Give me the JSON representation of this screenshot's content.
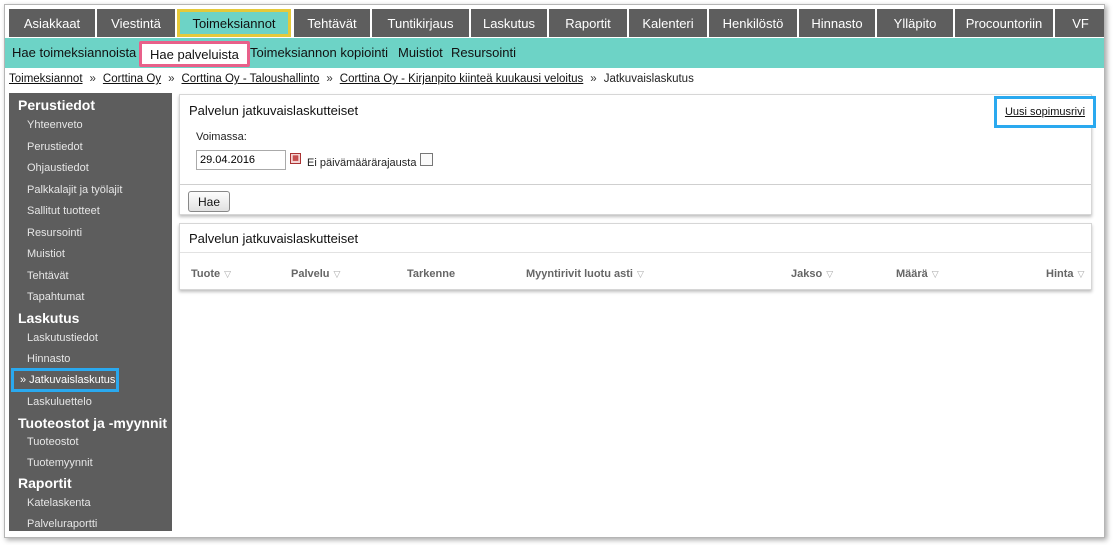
{
  "topnav": [
    {
      "label": "Asiakkaat"
    },
    {
      "label": "Viestintä"
    },
    {
      "label": "Toimeksiannot",
      "active": true
    },
    {
      "label": "Tehtävät"
    },
    {
      "label": "Tuntikirjaus"
    },
    {
      "label": "Laskutus"
    },
    {
      "label": "Raportit"
    },
    {
      "label": "Kalenteri"
    },
    {
      "label": "Henkilöstö"
    },
    {
      "label": "Hinnasto"
    },
    {
      "label": "Ylläpito"
    },
    {
      "label": "Procountoriin"
    },
    {
      "label": "VF"
    }
  ],
  "subnav": [
    {
      "label": "Hae toimeksiannoista"
    },
    {
      "label": "Hae palveluista",
      "active": true
    },
    {
      "label": "Toimeksiannon kopiointi"
    },
    {
      "label": "Muistiot"
    },
    {
      "label": "Resursointi"
    }
  ],
  "breadcrumb": [
    "Toimeksiannot",
    "Corttina Oy",
    "Corttina Oy - Taloushallinto",
    "Corttina Oy - Kirjanpito kiinteä kuukausi veloitus",
    "Jatkuvaislaskutus"
  ],
  "breadcrumb_separator": "»",
  "sidebar": {
    "sections": [
      {
        "heading": "Perustiedot",
        "items": [
          "Yhteenveto",
          "Perustiedot",
          "Ohjaustiedot",
          "Palkkalajit ja työlajit",
          "Sallitut tuotteet",
          "Resursointi",
          "Muistiot",
          "Tehtävät",
          "Tapahtumat"
        ]
      },
      {
        "heading": "Laskutus",
        "items": [
          "Laskutustiedot",
          "Hinnasto",
          "» Jatkuvaislaskutus",
          "Laskuluettelo"
        ]
      },
      {
        "heading": "Tuoteostot ja -myynnit",
        "items": [
          "Tuoteostot",
          "Tuotemyynnit"
        ]
      },
      {
        "heading": "Raportit",
        "items": [
          "Katelaskenta",
          "Palveluraportti"
        ]
      }
    ],
    "active_item": "» Jatkuvaislaskutus"
  },
  "search_panel": {
    "title": "Palvelun jatkuvaislaskutteiset",
    "new_row_link": "Uusi sopimusrivi",
    "valid_label": "Voimassa:",
    "date_value": "29.04.2016",
    "no_date_limit_label": "Ei päivämäärärajausta",
    "no_date_limit_checked": false,
    "search_button": "Hae"
  },
  "results_panel": {
    "title": "Palvelun jatkuvaislaskutteiset",
    "columns": [
      "Tuote",
      "Palvelu",
      "Tarkenne",
      "Myyntirivit luotu asti",
      "Jakso",
      "Määrä",
      "Hinta"
    ],
    "sortable": [
      true,
      true,
      false,
      true,
      true,
      true,
      true
    ]
  },
  "icons": {
    "sort": "sort-triangle-icon",
    "calendar": "calendar-icon"
  },
  "colors": {
    "nav_bg": "#5e5e5e",
    "accent_teal": "#6dd3c6",
    "highlight_yellow": "#e5c93a",
    "highlight_pink": "#e8608a",
    "highlight_blue": "#2aa9ef",
    "sidebar_bg": "#5d5d5d"
  }
}
